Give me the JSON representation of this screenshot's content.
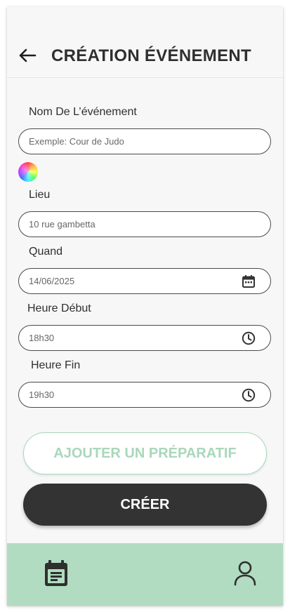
{
  "header": {
    "title": "CRÉATION ÉVÉNEMENT",
    "back_icon": "arrow-left-icon"
  },
  "form": {
    "event_name": {
      "label": "Nom De L’événement",
      "value": "",
      "placeholder": "Exemple: Cour de Judo"
    },
    "color_picker": {
      "icon": "color-wheel-icon"
    },
    "location": {
      "label": "Lieu",
      "value": "10 rue gambetta"
    },
    "date": {
      "label": "Quand",
      "value": "14/06/2025",
      "icon": "calendar-icon"
    },
    "start_time": {
      "label": "Heure Début",
      "value": "18h30",
      "icon": "clock-icon"
    },
    "end_time": {
      "label": "Heure Fin",
      "value": "19h30",
      "icon": "clock-icon"
    }
  },
  "actions": {
    "add_preparation": "AJOUTER UN PRÉPARATIF",
    "create": "CRÉER"
  },
  "bottom_nav": {
    "items": [
      {
        "icon": "calendar-icon"
      },
      {
        "icon": "user-icon"
      }
    ]
  },
  "colors": {
    "accent": "#b1dcc1",
    "primary_button": "#333333",
    "secondary_text": "#a9d7bb",
    "background": "#f7f7f7"
  }
}
